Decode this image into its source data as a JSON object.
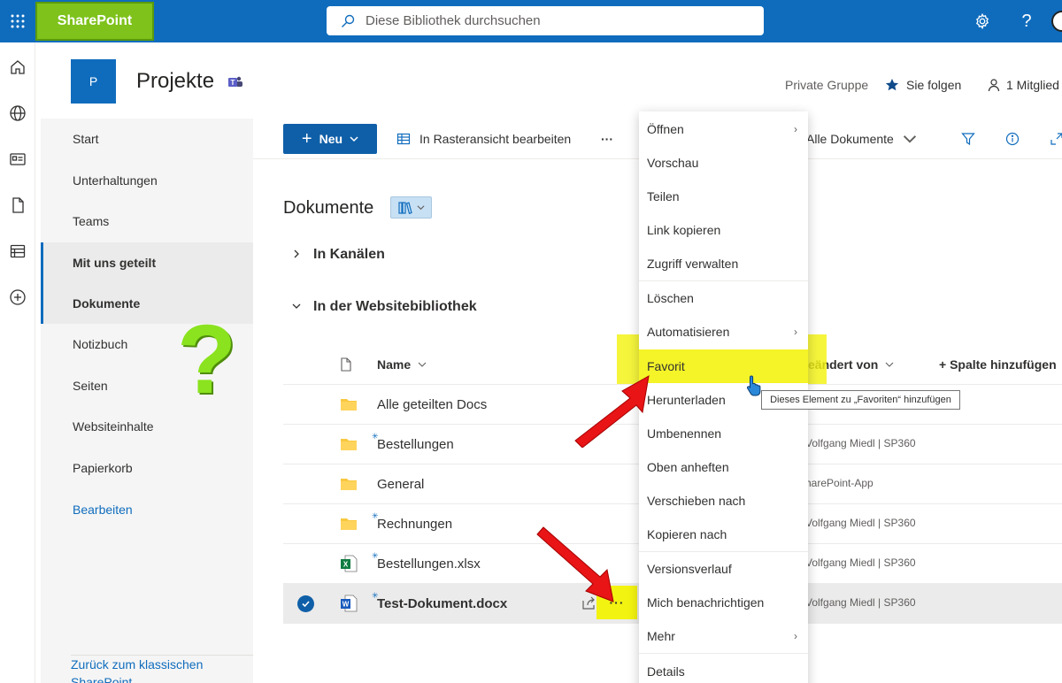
{
  "topbar": {
    "brand": "SharePoint",
    "search_placeholder": "Diese Bibliothek durchsuchen",
    "help_label": "?"
  },
  "site": {
    "logo_letter": "P",
    "title": "Projekte",
    "privacy": "Private Gruppe",
    "follow_label": "Sie folgen",
    "members_label": "1 Mitglied"
  },
  "nav": {
    "items": [
      {
        "label": "Start"
      },
      {
        "label": "Unterhaltungen"
      },
      {
        "label": "Teams"
      },
      {
        "label": "Mit uns geteilt"
      },
      {
        "label": "Dokumente"
      },
      {
        "label": "Notizbuch"
      },
      {
        "label": "Seiten"
      },
      {
        "label": "Websiteinhalte"
      },
      {
        "label": "Papierkorb"
      },
      {
        "label": "Bearbeiten"
      }
    ],
    "classic_link": "Zurück zum klassischen SharePoint",
    "annotation": "?"
  },
  "commands": {
    "new_label": "Neu",
    "grid_edit_label": "In Rasteransicht bearbeiten",
    "more": "···",
    "view_label": "Alle Dokumente"
  },
  "library": {
    "title": "Dokumente",
    "group_channels": "In Kanälen",
    "group_site": "In der Websitebibliothek",
    "columns": {
      "name": "Name",
      "modified_by": "eändert von",
      "add_column": "+ Spalte hinzufügen"
    },
    "rows": [
      {
        "name": "Alle geteilten Docs",
        "type": "folder",
        "modified_by": ""
      },
      {
        "name": "Bestellungen",
        "type": "folder",
        "modified_by": "Volfgang Miedl | SP360"
      },
      {
        "name": "General",
        "type": "folder",
        "modified_by": "harePoint-App"
      },
      {
        "name": "Rechnungen",
        "type": "folder",
        "modified_by": "Volfgang Miedl | SP360"
      },
      {
        "name": "Bestellungen.xlsx",
        "type": "excel",
        "modified_by": "Volfgang Miedl | SP360"
      },
      {
        "name": "Test-Dokument.docx",
        "type": "word",
        "modified_by": "Volfgang Miedl | SP360"
      }
    ]
  },
  "context_menu": {
    "items": [
      {
        "label": "Öffnen",
        "sub": true
      },
      {
        "label": "Vorschau"
      },
      {
        "label": "Teilen"
      },
      {
        "label": "Link kopieren"
      },
      {
        "label": "Zugriff verwalten"
      },
      {
        "label": "Löschen"
      },
      {
        "label": "Automatisieren",
        "sub": true
      },
      {
        "label": "Favorit"
      },
      {
        "label": "Herunterladen"
      },
      {
        "label": "Umbenennen"
      },
      {
        "label": "Oben anheften"
      },
      {
        "label": "Verschieben nach"
      },
      {
        "label": "Kopieren nach"
      },
      {
        "label": "Versionsverlauf"
      },
      {
        "label": "Mich benachrichtigen"
      },
      {
        "label": "Mehr",
        "sub": true
      },
      {
        "label": "Details"
      }
    ],
    "tooltip": "Dieses Element zu „Favoriten“ hinzufügen"
  },
  "colors": {
    "accent": "#0f6cbd",
    "highlight": "#f3f311",
    "arrow": "#e81416",
    "annotation_green": "#8ae31e"
  }
}
